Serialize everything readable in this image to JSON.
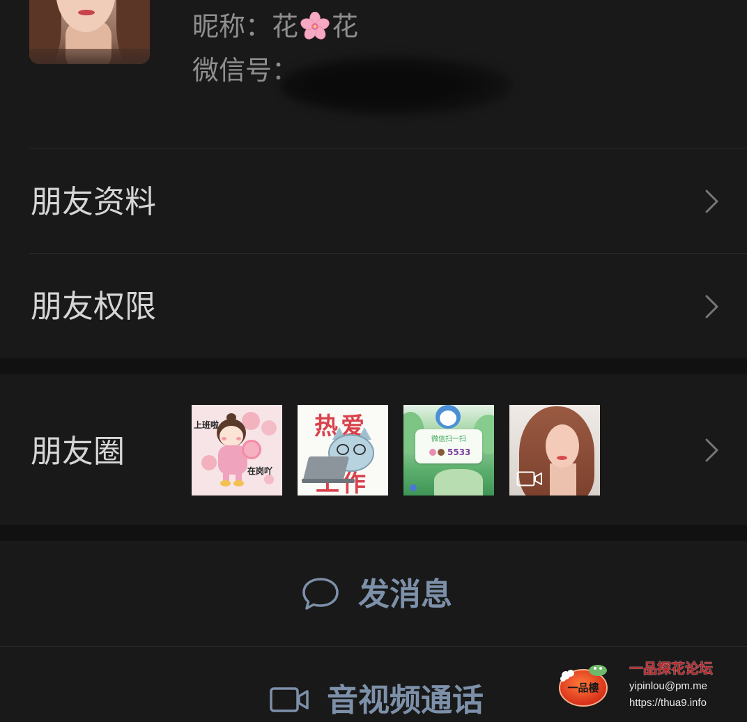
{
  "colors": {
    "background": "#191919",
    "band": "#111111",
    "primary_text": "#d6d6d6",
    "secondary_text": "#8f8f8f",
    "link": "#7d90a9",
    "divider": "#2a2a2a",
    "chevron": "#767676"
  },
  "profile": {
    "nickname_label": "昵称：",
    "nickname_prefix": "花",
    "nickname_emoji_icon": "cherry-blossom-icon",
    "nickname_suffix": "花",
    "wechat_id_label": "微信号："
  },
  "menu": {
    "items": [
      {
        "label": "朋友资料",
        "icon": "chevron-right-icon"
      },
      {
        "label": "朋友权限",
        "icon": "chevron-right-icon"
      }
    ]
  },
  "moments": {
    "label": "朋友圈",
    "icon": "chevron-right-icon",
    "thumbnails": [
      {
        "texts": [
          "上班啦",
          "在岗吖"
        ]
      },
      {
        "texts": [
          "热爱",
          "工作"
        ]
      },
      {
        "texts": [
          "微信扫一扫",
          "5533"
        ]
      },
      {
        "icon": "video-icon"
      }
    ]
  },
  "actions": {
    "send_message": {
      "label": "发消息",
      "icon": "chat-bubble-icon"
    },
    "av_call": {
      "label": "音视频通话",
      "icon": "video-camera-icon"
    }
  },
  "watermark": {
    "logo_text": "一品樓",
    "title": "一品探花论坛",
    "email": "yipinlou@pm.me",
    "url": "https://thua9.info"
  }
}
